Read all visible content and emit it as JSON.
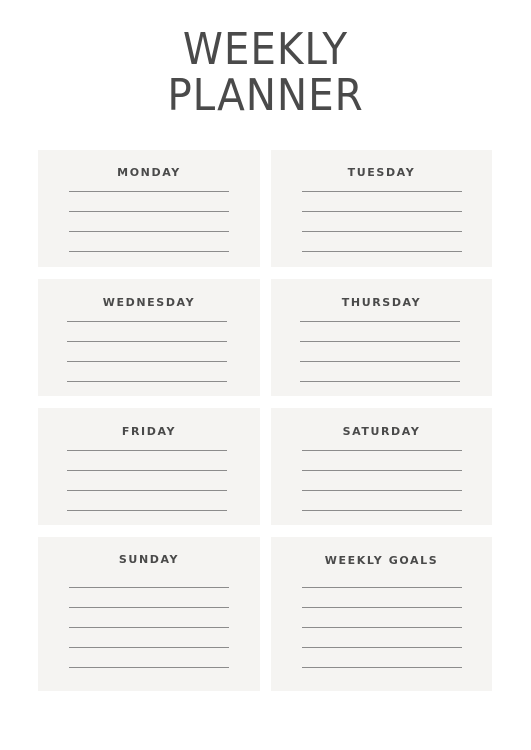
{
  "title": {
    "line1": "WEEKLY",
    "line2": "PLANNER"
  },
  "cards": [
    {
      "label": "MONDAY"
    },
    {
      "label": "TUESDAY"
    },
    {
      "label": "WEDNESDAY"
    },
    {
      "label": "THURSDAY"
    },
    {
      "label": "FRIDAY"
    },
    {
      "label": "SATURDAY"
    },
    {
      "label": "SUNDAY"
    },
    {
      "label": "WEEKLY GOALS"
    }
  ],
  "colors": {
    "card_background": "#f5f4f2",
    "text": "#4a4a4a",
    "rule_line": "#8c8c8c"
  }
}
